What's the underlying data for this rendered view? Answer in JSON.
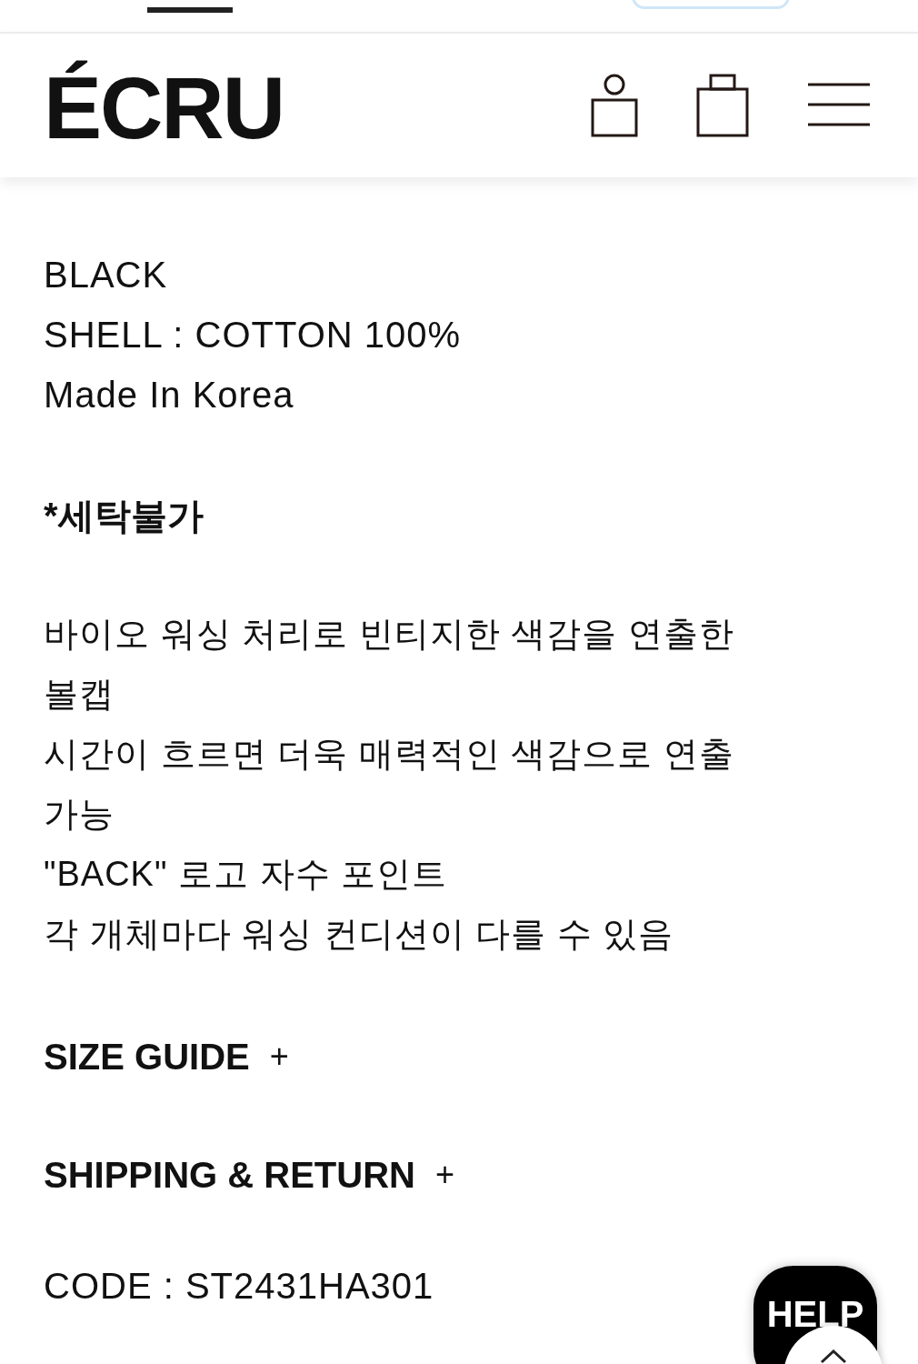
{
  "top_strip": {
    "tabs": [
      {
        "selected": true
      }
    ]
  },
  "header": {
    "logo": "ÉCRU"
  },
  "details": [
    "BLACK",
    "SHELL : COTTON 100%",
    "Made In Korea"
  ],
  "notice": "*세탁불가",
  "description": [
    "바이오 워싱 처리로 빈티지한 색감을 연출한 볼캡",
    "시간이 흐르면 더욱 매력적인 색감으로 연출 가능",
    "\"BACK\" 로고 자수 포인트",
    "각 개체마다 워싱 컨디션이 다를 수 있음"
  ],
  "sections": [
    {
      "label": "SIZE GUIDE",
      "toggle": "+",
      "expanded": false
    },
    {
      "label": "SHIPPING & RETURN",
      "toggle": "+",
      "expanded": false
    }
  ],
  "code": "CODE : ST2431HA301",
  "help_button": {
    "label": "HELP"
  }
}
